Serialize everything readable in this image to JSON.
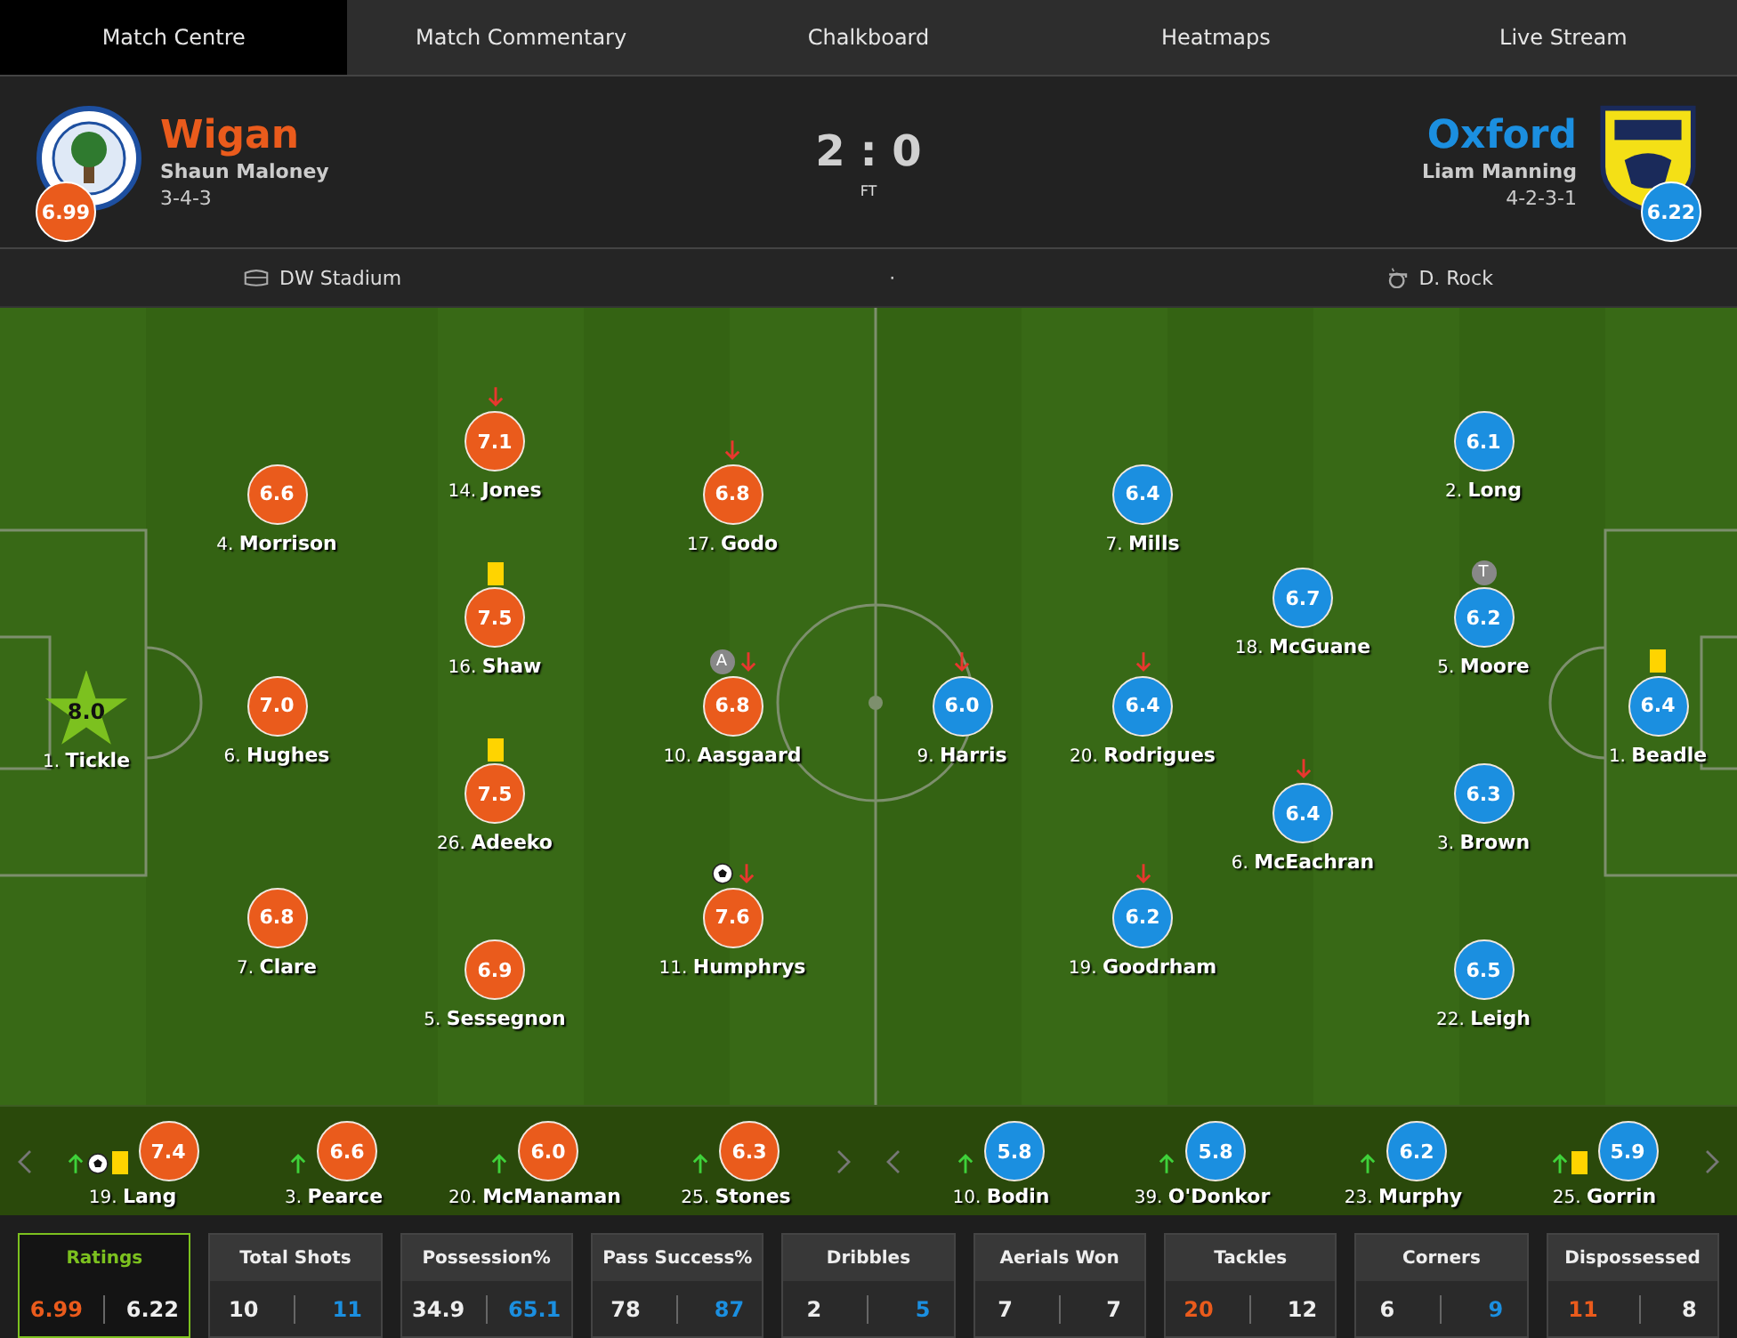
{
  "tabs": [
    {
      "label": "Match Centre",
      "selected": true
    },
    {
      "label": "Match Commentary",
      "selected": false
    },
    {
      "label": "Chalkboard",
      "selected": false
    },
    {
      "label": "Heatmaps",
      "selected": false
    },
    {
      "label": "Live Stream",
      "selected": false
    }
  ],
  "home": {
    "name": "Wigan",
    "manager": "Shaun Maloney",
    "formation": "3-4-3",
    "rating": "6.99"
  },
  "away": {
    "name": "Oxford",
    "manager": "Liam Manning",
    "formation": "4-2-3-1",
    "rating": "6.22"
  },
  "score": "2 : 0",
  "status": "FT",
  "venue": "DW Stadium",
  "separator": "·",
  "referee": "D. Rock",
  "lineups": {
    "home": [
      [
        {
          "number": "1.",
          "name": "Tickle",
          "rating": "8.0",
          "motm": true
        }
      ],
      [
        {
          "number": "4.",
          "name": "Morrison",
          "rating": "6.6",
          "motm": false
        },
        {
          "number": "6.",
          "name": "Hughes",
          "rating": "7.0",
          "motm": false
        },
        {
          "number": "7.",
          "name": "Clare",
          "rating": "6.8",
          "motm": false
        }
      ],
      [
        {
          "number": "14.",
          "name": "Jones",
          "rating": "7.1",
          "motm": false,
          "events": [
            {
              "kind": "sub_off"
            }
          ]
        },
        {
          "number": "16.",
          "name": "Shaw",
          "rating": "7.5",
          "motm": false,
          "events": [
            {
              "kind": "yellow_card"
            }
          ]
        },
        {
          "number": "26.",
          "name": "Adeeko",
          "rating": "7.5",
          "motm": false,
          "events": [
            {
              "kind": "yellow_card"
            }
          ]
        },
        {
          "number": "5.",
          "name": "Sessegnon",
          "rating": "6.9",
          "motm": false
        }
      ],
      [
        {
          "number": "17.",
          "name": "Godo",
          "rating": "6.8",
          "motm": false,
          "events": [
            {
              "kind": "sub_off"
            }
          ]
        },
        {
          "number": "10.",
          "name": "Aasgaard",
          "rating": "6.8",
          "motm": false,
          "events": [
            {
              "kind": "badge",
              "text": "A"
            },
            {
              "kind": "sub_off"
            }
          ]
        },
        {
          "number": "11.",
          "name": "Humphrys",
          "rating": "7.6",
          "motm": false,
          "events": [
            {
              "kind": "goal"
            },
            {
              "kind": "sub_off"
            }
          ]
        }
      ]
    ],
    "away": [
      [
        {
          "number": "9.",
          "name": "Harris",
          "rating": "6.0",
          "motm": false,
          "events": [
            {
              "kind": "sub_off"
            }
          ]
        }
      ],
      [
        {
          "number": "7.",
          "name": "Mills",
          "rating": "6.4",
          "motm": false
        },
        {
          "number": "20.",
          "name": "Rodrigues",
          "rating": "6.4",
          "motm": false,
          "events": [
            {
              "kind": "sub_off"
            }
          ]
        },
        {
          "number": "19.",
          "name": "Goodrham",
          "rating": "6.2",
          "motm": false,
          "events": [
            {
              "kind": "sub_off"
            }
          ]
        }
      ],
      [
        {
          "number": "18.",
          "name": "McGuane",
          "rating": "6.7",
          "motm": false
        },
        {
          "number": "6.",
          "name": "McEachran",
          "rating": "6.4",
          "motm": false,
          "events": [
            {
              "kind": "sub_off"
            }
          ]
        }
      ],
      [
        {
          "number": "2.",
          "name": "Long",
          "rating": "6.1",
          "motm": false
        },
        {
          "number": "5.",
          "name": "Moore",
          "rating": "6.2",
          "motm": false,
          "events": [
            {
              "kind": "badge",
              "text": "T"
            }
          ]
        },
        {
          "number": "3.",
          "name": "Brown",
          "rating": "6.3",
          "motm": false
        },
        {
          "number": "22.",
          "name": "Leigh",
          "rating": "6.5",
          "motm": false
        }
      ],
      [
        {
          "number": "1.",
          "name": "Beadle",
          "rating": "6.4",
          "motm": false,
          "events": [
            {
              "kind": "yellow_card"
            }
          ]
        }
      ]
    ]
  },
  "subs": {
    "home": [
      {
        "number": "19.",
        "name": "Lang",
        "rating": "7.4",
        "events": [
          {
            "kind": "sub_on"
          },
          {
            "kind": "goal"
          },
          {
            "kind": "yellow_card"
          }
        ]
      },
      {
        "number": "3.",
        "name": "Pearce",
        "rating": "6.6",
        "events": [
          {
            "kind": "sub_on"
          }
        ]
      },
      {
        "number": "20.",
        "name": "McManaman",
        "rating": "6.0",
        "events": [
          {
            "kind": "sub_on"
          }
        ]
      },
      {
        "number": "25.",
        "name": "Stones",
        "rating": "6.3",
        "events": [
          {
            "kind": "sub_on"
          }
        ]
      }
    ],
    "away": [
      {
        "number": "10.",
        "name": "Bodin",
        "rating": "5.8",
        "events": [
          {
            "kind": "sub_on"
          }
        ]
      },
      {
        "number": "39.",
        "name": "O'Donkor",
        "rating": "5.8",
        "events": [
          {
            "kind": "sub_on"
          }
        ]
      },
      {
        "number": "23.",
        "name": "Murphy",
        "rating": "6.2",
        "events": [
          {
            "kind": "sub_on"
          }
        ]
      },
      {
        "number": "25.",
        "name": "Gorrin",
        "rating": "5.9",
        "events": [
          {
            "kind": "sub_on"
          },
          {
            "kind": "yellow_card"
          }
        ]
      }
    ]
  },
  "stats": [
    {
      "label": "Ratings",
      "selected": true,
      "home": {
        "value": "6.99",
        "highlight": true
      },
      "away": {
        "value": "6.22",
        "highlight": false
      }
    },
    {
      "label": "Total Shots",
      "selected": false,
      "home": {
        "value": "10",
        "highlight": false
      },
      "away": {
        "value": "11",
        "highlight": true
      }
    },
    {
      "label": "Possession%",
      "selected": false,
      "home": {
        "value": "34.9",
        "highlight": false
      },
      "away": {
        "value": "65.1",
        "highlight": true
      }
    },
    {
      "label": "Pass Success%",
      "selected": false,
      "home": {
        "value": "78",
        "highlight": false
      },
      "away": {
        "value": "87",
        "highlight": true
      }
    },
    {
      "label": "Dribbles",
      "selected": false,
      "home": {
        "value": "2",
        "highlight": false
      },
      "away": {
        "value": "5",
        "highlight": true
      }
    },
    {
      "label": "Aerials Won",
      "selected": false,
      "home": {
        "value": "7",
        "highlight": false
      },
      "away": {
        "value": "7",
        "highlight": false
      }
    },
    {
      "label": "Tackles",
      "selected": false,
      "home": {
        "value": "20",
        "highlight": true
      },
      "away": {
        "value": "12",
        "highlight": false
      }
    },
    {
      "label": "Corners",
      "selected": false,
      "home": {
        "value": "6",
        "highlight": false
      },
      "away": {
        "value": "9",
        "highlight": true
      }
    },
    {
      "label": "Dispossessed",
      "selected": false,
      "home": {
        "value": "11",
        "highlight": true
      },
      "away": {
        "value": "8",
        "highlight": false
      }
    }
  ]
}
